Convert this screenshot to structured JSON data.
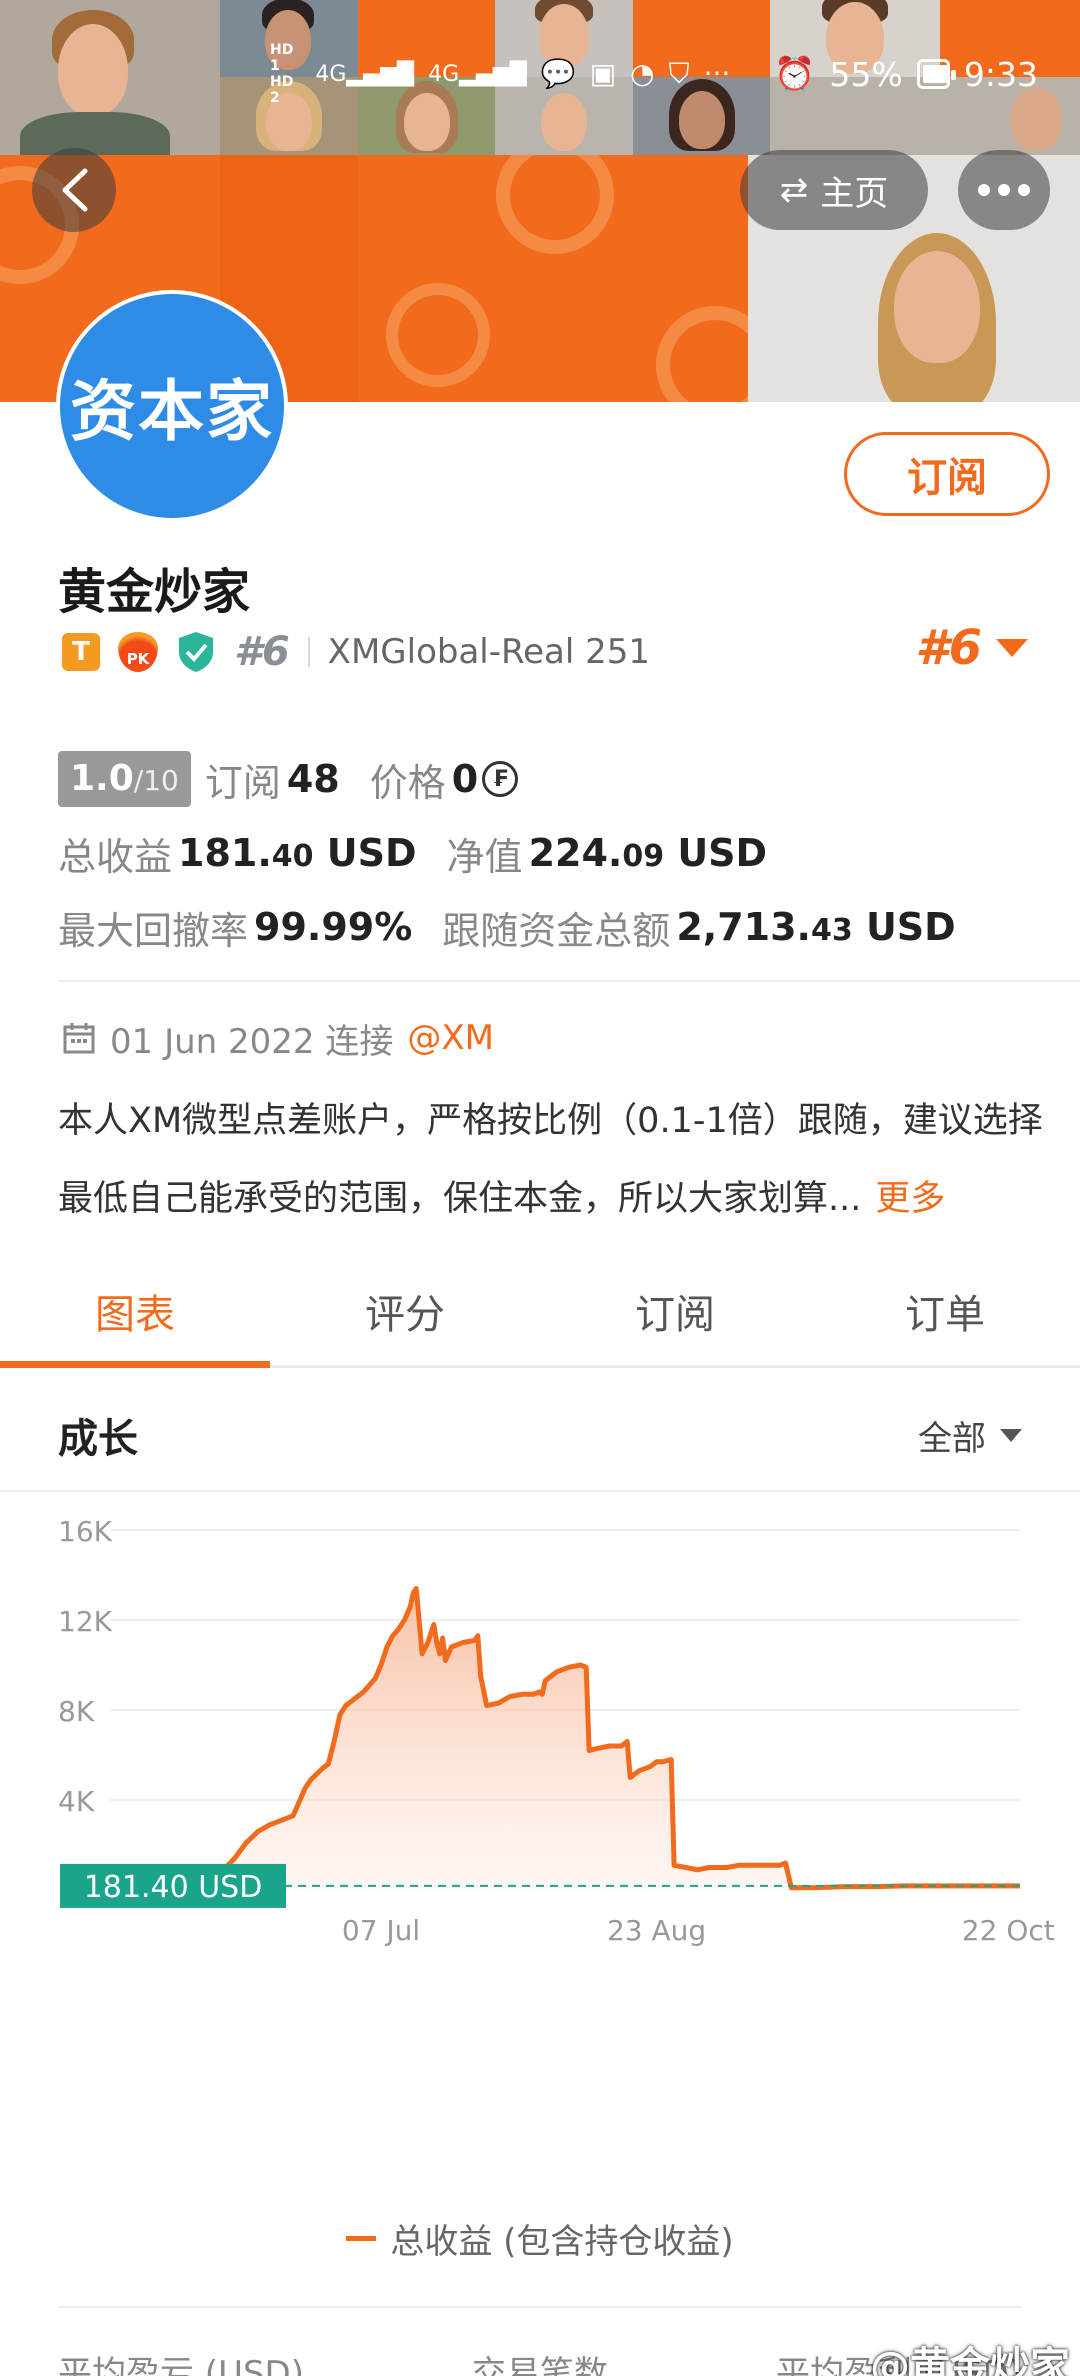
{
  "status_bar": {
    "hd1": "HD 1",
    "hd2": "HD 2",
    "network": "4G",
    "battery_percent": "55%",
    "time": "9:33"
  },
  "header": {
    "home_label": "主页"
  },
  "profile": {
    "avatar_text": "资本家",
    "subscribe_label": "订阅",
    "name": "黄金炒家",
    "badge_t": "T",
    "badge_pk": "PK",
    "rank": "#6",
    "account": "XMGlobal-Real 251",
    "rank_right": "#6"
  },
  "stats": {
    "score_int": "1.0",
    "score_max": "/10",
    "subs_label": "订阅",
    "subs_value": "48",
    "price_label": "价格",
    "price_value": "0",
    "currency_symbol": "₣",
    "total_profit_label": "总收益",
    "total_profit_main": "181.",
    "total_profit_dec": "40",
    "total_profit_unit": "USD",
    "equity_label": "净值",
    "equity_main": "224.",
    "equity_dec": "09",
    "equity_unit": "USD",
    "drawdown_label": "最大回撤率",
    "drawdown_value": "99.99%",
    "follow_label": "跟随资金总额",
    "follow_main": "2,713.",
    "follow_dec": "43",
    "follow_unit": "USD"
  },
  "info": {
    "date": "01 Jun 2022 连接",
    "broker": "@XM",
    "description": "本人XM微型点差账户，严格按比例（0.1-1倍）跟随，建议选择最低自己能承受的范围，保住本金，所以大家划算...",
    "more_label": "更多"
  },
  "tabs": [
    "图表",
    "评分",
    "订阅",
    "订单"
  ],
  "section": {
    "title": "成长",
    "filter_label": "全部"
  },
  "chart_data": {
    "type": "area",
    "y_ticks": [
      "16K",
      "12K",
      "8K",
      "4K"
    ],
    "ylim": [
      0,
      16000
    ],
    "x_ticks": [
      {
        "label": "07 Jul",
        "x": 36
      },
      {
        "label": "23 Aug",
        "x": 83
      },
      {
        "label": "22 Oct",
        "x": 143
      }
    ],
    "xlim": [
      0,
      145
    ],
    "current_label": "181.40 USD",
    "current_value": 181.4,
    "series": [
      {
        "name": "总收益 (包含持仓收益)",
        "color": "#f26b1d",
        "points": [
          [
            0,
            0
          ],
          [
            5,
            0
          ],
          [
            8,
            600
          ],
          [
            11,
            1400
          ],
          [
            13,
            2100
          ],
          [
            15,
            2600
          ],
          [
            17,
            2900
          ],
          [
            19,
            3100
          ],
          [
            21,
            3300
          ],
          [
            22,
            3900
          ],
          [
            23,
            4500
          ],
          [
            24,
            4900
          ],
          [
            26,
            5400
          ],
          [
            27,
            5600
          ],
          [
            28,
            6600
          ],
          [
            29,
            7800
          ],
          [
            30,
            8200
          ],
          [
            32,
            8600
          ],
          [
            33,
            8800
          ],
          [
            34,
            9100
          ],
          [
            35,
            9400
          ],
          [
            36,
            10000
          ],
          [
            37,
            10800
          ],
          [
            38,
            11300
          ],
          [
            39,
            11600
          ],
          [
            40,
            12000
          ],
          [
            41,
            12600
          ],
          [
            41.5,
            13200
          ],
          [
            42,
            13400
          ],
          [
            42.5,
            12000
          ],
          [
            43,
            10500
          ],
          [
            44,
            11000
          ],
          [
            45,
            11800
          ],
          [
            45.5,
            11000
          ],
          [
            46,
            10500
          ],
          [
            46.5,
            11200
          ],
          [
            47,
            10200
          ],
          [
            48,
            10800
          ],
          [
            50,
            11000
          ],
          [
            52,
            11100
          ],
          [
            52.5,
            11300
          ],
          [
            53,
            9500
          ],
          [
            54,
            8200
          ],
          [
            56,
            8300
          ],
          [
            58,
            8600
          ],
          [
            60,
            8700
          ],
          [
            62,
            8700
          ],
          [
            63,
            8800
          ],
          [
            63.5,
            8700
          ],
          [
            64,
            9300
          ],
          [
            66,
            9700
          ],
          [
            68,
            9900
          ],
          [
            70,
            10000
          ],
          [
            71,
            9900
          ],
          [
            71.5,
            6200
          ],
          [
            73,
            6300
          ],
          [
            75,
            6400
          ],
          [
            77,
            6400
          ],
          [
            78,
            6600
          ],
          [
            78.5,
            5000
          ],
          [
            80,
            5300
          ],
          [
            82,
            5500
          ],
          [
            83,
            5700
          ],
          [
            84,
            5700
          ],
          [
            85.5,
            5800
          ],
          [
            86,
            1100
          ],
          [
            88,
            1000
          ],
          [
            90,
            900
          ],
          [
            92,
            1000
          ],
          [
            95,
            1000
          ],
          [
            97,
            1100
          ],
          [
            100,
            1100
          ],
          [
            104,
            1100
          ],
          [
            105,
            1200
          ],
          [
            106,
            100
          ],
          [
            110,
            100
          ],
          [
            115,
            150
          ],
          [
            120,
            150
          ],
          [
            125,
            181
          ],
          [
            145,
            181
          ]
        ]
      }
    ],
    "colors": {
      "line": "#f26b1d",
      "label_bg": "#1aa58b",
      "baseline": "#1aa58b"
    }
  },
  "bottom_labels": [
    "平均盈亏 (USD)",
    "交易笔数",
    "平均盈利 (USD)"
  ],
  "watermark": "@黄金炒家"
}
